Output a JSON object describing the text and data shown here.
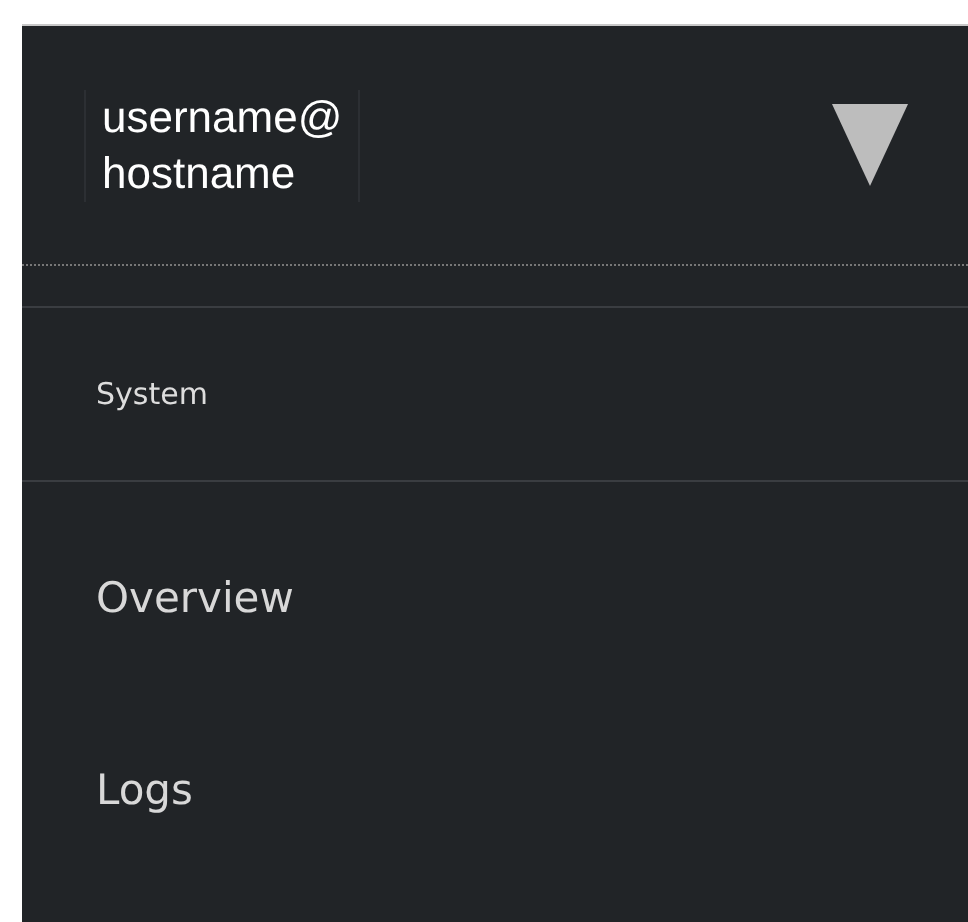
{
  "host_switcher": {
    "user": "username@",
    "host": "hostname"
  },
  "nav": {
    "section": "System",
    "items": [
      {
        "label": "Overview",
        "selected": false
      },
      {
        "label": "Logs",
        "selected": false
      }
    ]
  }
}
